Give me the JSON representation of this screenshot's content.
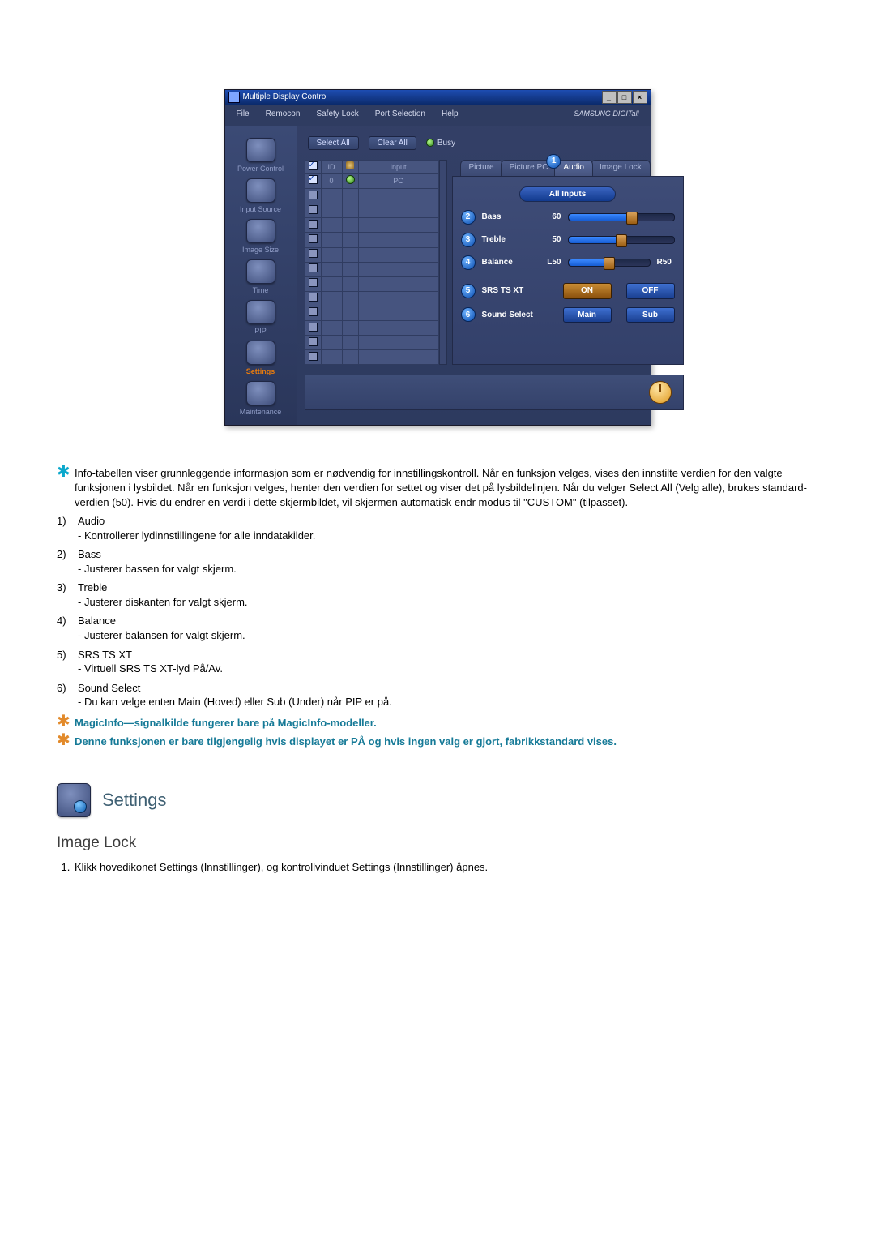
{
  "app_window": {
    "title": "Multiple Display Control",
    "menu": [
      "File",
      "Remocon",
      "Safety Lock",
      "Port Selection",
      "Help"
    ],
    "brand": "SAMSUNG DIGITall",
    "win_controls": {
      "min": "_",
      "max": "□",
      "close": "×"
    },
    "toolbar": {
      "select_all": "Select All",
      "clear_all": "Clear All",
      "busy": "Busy"
    },
    "sidebar": [
      {
        "label": "Power Control"
      },
      {
        "label": "Input Source"
      },
      {
        "label": "Image Size"
      },
      {
        "label": "Time"
      },
      {
        "label": "PIP"
      },
      {
        "label": "Settings"
      },
      {
        "label": "Maintenance"
      }
    ],
    "grid": {
      "headers": {
        "chk": "",
        "id": "ID",
        "icon": "",
        "input": "Input"
      },
      "row0": {
        "id": "0",
        "input": "PC"
      }
    },
    "tabs": {
      "picture": "Picture",
      "picture_pc": "Picture PC",
      "audio": "Audio",
      "image_lock": "Image Lock"
    },
    "pane": {
      "all_inputs": "All Inputs",
      "bass": {
        "label": "Bass",
        "value_text": "60",
        "value": 60
      },
      "treble": {
        "label": "Treble",
        "value_text": "50",
        "value": 50
      },
      "balance": {
        "label": "Balance",
        "left_text": "L50",
        "right_text": "R50",
        "value": 50
      },
      "srs": {
        "label": "SRS TS XT",
        "on": "ON",
        "off": "OFF"
      },
      "sound_select": {
        "label": "Sound Select",
        "main": "Main",
        "sub": "Sub"
      }
    },
    "callouts": {
      "one": "1",
      "two": "2",
      "three": "3",
      "four": "4",
      "five": "5",
      "six": "6"
    }
  },
  "explain": {
    "intro": "Info-tabellen viser grunnleggende informasjon som er nødvendig for innstillingskontroll. Når en funksjon velges, vises den innstilte verdien for den valgte funksjonen i lysbildet. Når en funksjon velges, henter den verdien for settet og viser det på lysbildelinjen. Når du velger Select All (Velg alle), brukes standard­verdien (50). Hvis du endrer en verdi i dette skjermbildet, vil skjermen automatisk endr modus til \"CUSTOM\" (tilpasset).",
    "items": [
      {
        "key": "1)",
        "title": "Audio",
        "desc": "- Kontrollerer lydinnstillingene for alle inndatakilder."
      },
      {
        "key": "2)",
        "title": "Bass",
        "desc": "- Justerer bassen for valgt skjerm."
      },
      {
        "key": "3)",
        "title": "Treble",
        "desc": "- Justerer diskanten for valgt skjerm."
      },
      {
        "key": "4)",
        "title": "Balance",
        "desc": "- Justerer balansen for valgt skjerm."
      },
      {
        "key": "5)",
        "title": "SRS TS XT",
        "desc": "- Virtuell SRS TS XT-lyd På/Av."
      },
      {
        "key": "6)",
        "title": "Sound Select",
        "desc": "- Du kan velge enten Main (Hoved) eller Sub (Under) når PIP er på."
      }
    ],
    "note_magicinfo": "MagicInfo—signalkilde fungerer bare på MagicInfo-modeller.",
    "note_availability": "Denne funksjonen er bare tilgjengelig hvis displayet er PÅ og hvis ingen valg er gjort, fabrikkstandard vises."
  },
  "section": {
    "heading": "Settings",
    "subheading": "Image Lock",
    "step1": "Klikk hovedikonet Settings (Innstillinger), og kontrollvinduet Settings (Innstillinger) åpnes."
  }
}
